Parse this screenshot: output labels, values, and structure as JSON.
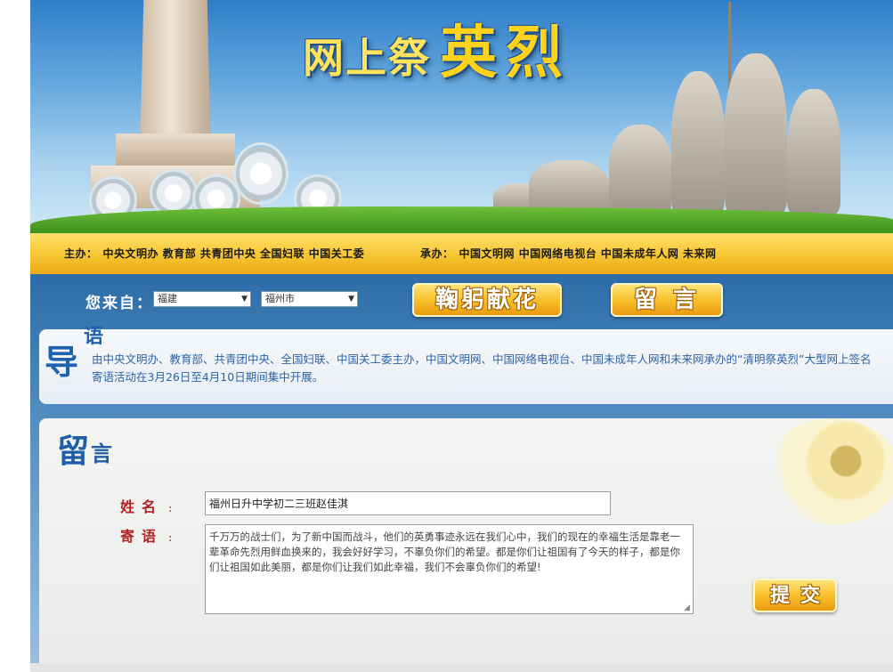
{
  "banner": {
    "title_part1": "网上祭",
    "title_part2": "英烈"
  },
  "sponsors": {
    "host_label": "主办：",
    "host_names": "中央文明办  教育部  共青团中央  全国妇联  中国关工委",
    "organizer_label": "承办：",
    "organizer_names": "中国文明网  中国网络电视台  中国未成年人网  未来网"
  },
  "nav": {
    "from_label": "您来自：",
    "province": "福建",
    "city": "福州市",
    "bow_button": "鞠躬献花",
    "message_button": "留言"
  },
  "intro": {
    "title_big": "导",
    "title_small": "语",
    "text": "由中央文明办、教育部、共青团中央、全国妇联、中国关工委主办，中国文明网、中国网络电视台、中国未成年人网和未来网承办的“清明祭英烈”大型网上签名寄语活动在3月26日至4月10日期间集中开展。"
  },
  "message": {
    "title_big": "留",
    "title_small": "言",
    "name_label": "姓名",
    "name_value": "福州日升中学初二三班赵佳淇",
    "msg_label": "寄语",
    "msg_value": "千万万的战士们，为了新中国而战斗，他们的英勇事迹永远在我们心中，我们的现在的幸福生活是靠老一辈革命先烈用鲜血换来的，我会好好学习，不辜负你们的希望。都是你们让祖国有了今天的样子，都是你们让祖国如此美丽，都是你们让我们如此幸福，我们不会辜负你们的希望!",
    "submit_button": "提交"
  }
}
